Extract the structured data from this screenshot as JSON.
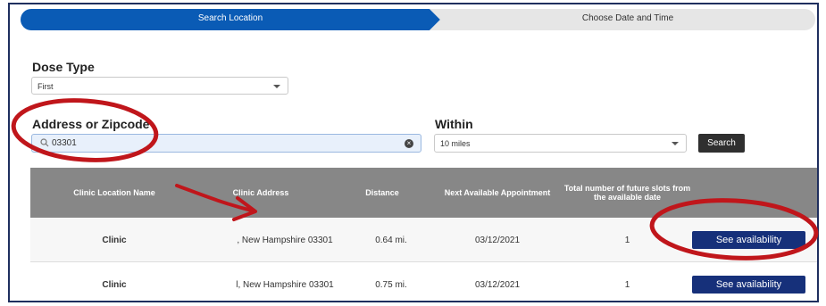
{
  "stepper": {
    "steps": [
      {
        "label": "Search Location",
        "active": true
      },
      {
        "label": "Choose Date and Time",
        "active": false
      }
    ]
  },
  "dose_type": {
    "label": "Dose Type",
    "value": "First"
  },
  "address": {
    "label": "Address or Zipcode",
    "value": "03301"
  },
  "within": {
    "label": "Within",
    "value": "10 miles"
  },
  "search_button": "Search",
  "table": {
    "headers": [
      "Clinic Location Name",
      "Clinic Address",
      "Distance",
      "Next Available Appointment",
      "Total number of future slots from the available date"
    ],
    "rows": [
      {
        "name": "Clinic",
        "address": ", New Hampshire 03301",
        "distance": "0.64 mi.",
        "next": "03/12/2021",
        "slots": "1",
        "button": "See availability"
      },
      {
        "name": "Clinic",
        "address": "l, New Hampshire 03301",
        "distance": "0.75 mi.",
        "next": "03/12/2021",
        "slots": "1",
        "button": "See availability"
      }
    ]
  },
  "colors": {
    "active_step": "#0a5bb5",
    "table_header": "#878787",
    "button": "#16307a",
    "annotation": "#c0161b"
  }
}
